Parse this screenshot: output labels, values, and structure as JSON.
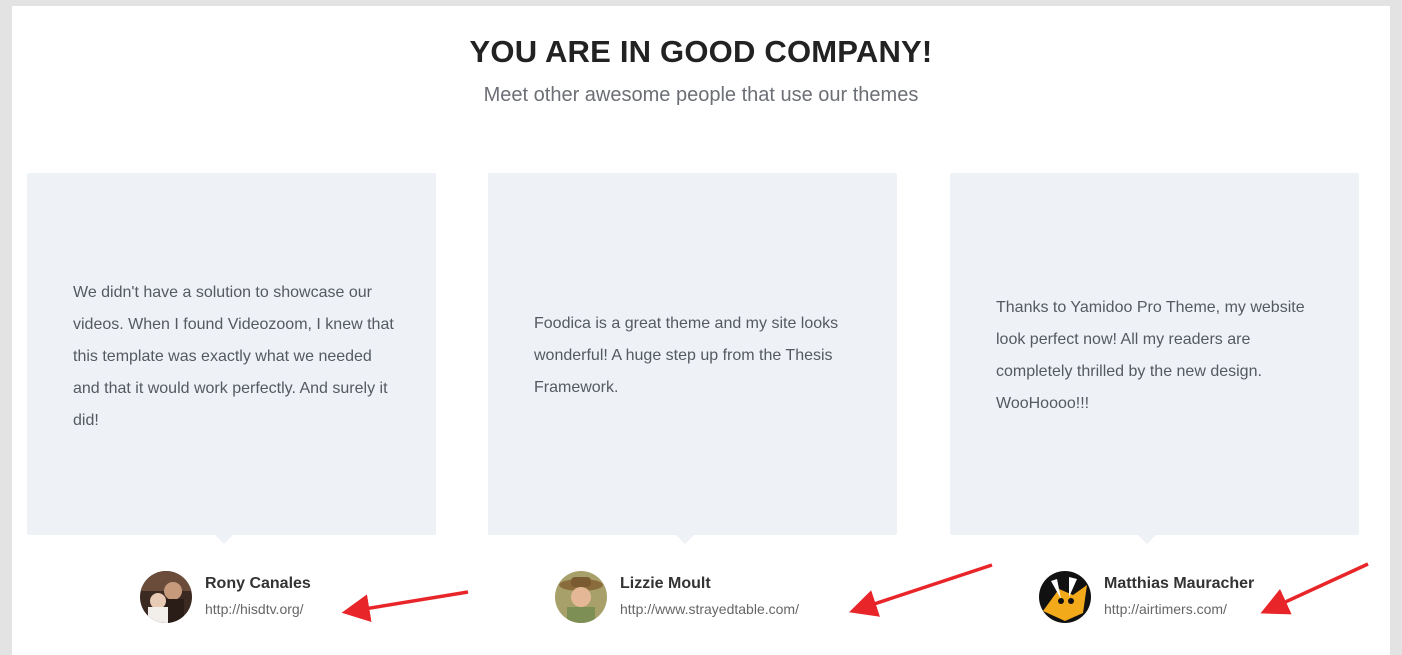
{
  "section": {
    "title": "YOU ARE IN GOOD COMPANY!",
    "subtitle": "Meet other awesome people that use our themes"
  },
  "testimonials": [
    {
      "quote": "We didn't have a solution to showcase our videos. When I found Videozoom, I knew that this template was exactly what we needed and that it would work perfectly. And surely it did!",
      "name": "Rony Canales",
      "url": "http://hisdtv.org/"
    },
    {
      "quote": "Foodica is a great theme and my site looks wonderful! A huge step up from the Thesis Framework.",
      "name": "Lizzie Moult",
      "url": "http://www.strayedtable.com/"
    },
    {
      "quote": "Thanks to Yamidoo Pro Theme, my website look perfect now! All my readers are completely thrilled by the new design. WooHoooo!!!",
      "name": "Matthias Mauracher",
      "url": "http://airtimers.com/"
    }
  ],
  "colors": {
    "card_bg": "#eef1f6",
    "annotation_arrow": "#e8262a"
  }
}
